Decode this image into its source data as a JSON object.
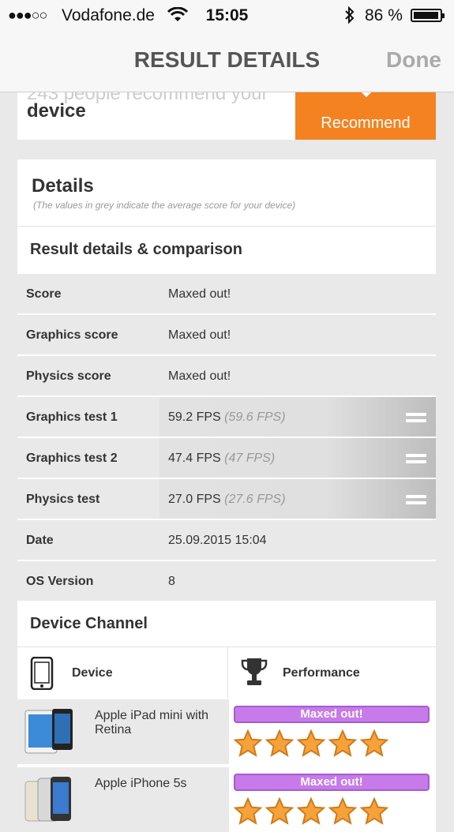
{
  "status_bar": {
    "signal": "●●●○○",
    "carrier": "Vodafone.de",
    "time": "15:05",
    "battery_percent": "86 %",
    "battery_level": 0.86
  },
  "nav": {
    "title": "RESULT DETAILS",
    "done_label": "Done"
  },
  "recommend_card": {
    "line1": "243 people recommend your",
    "line2": "device",
    "button_label": "Recommend"
  },
  "details": {
    "title": "Details",
    "subtitle": "(The values in grey indicate the average score for your device)",
    "comparison_title": "Result details & comparison",
    "rows": [
      {
        "label": "Score",
        "value": "Maxed out!",
        "avg": ""
      },
      {
        "label": "Graphics score",
        "value": "Maxed out!",
        "avg": ""
      },
      {
        "label": "Physics score",
        "value": "Maxed out!",
        "avg": ""
      },
      {
        "label": "Graphics test 1",
        "value": "59.2 FPS",
        "avg": "(59.6 FPS)"
      },
      {
        "label": "Graphics test 2",
        "value": "47.4 FPS",
        "avg": "(47 FPS)"
      },
      {
        "label": "Physics test",
        "value": "27.0 FPS",
        "avg": "(27.6 FPS)"
      },
      {
        "label": "Date",
        "value": "25.09.2015 15:04",
        "avg": ""
      },
      {
        "label": "OS Version",
        "value": "8",
        "avg": ""
      }
    ]
  },
  "channel": {
    "title": "Device Channel",
    "col_device": "Device",
    "col_performance": "Performance",
    "devices": [
      {
        "name": "Apple iPad mini with Retina",
        "performance": "Maxed out!",
        "stars": 5
      },
      {
        "name": "Apple iPhone 5s",
        "performance": "Maxed out!",
        "stars": 5
      }
    ]
  },
  "colors": {
    "accent_orange": "#f48221",
    "performance_purple": "#c77be9",
    "star_orange": "#f5a23a"
  }
}
